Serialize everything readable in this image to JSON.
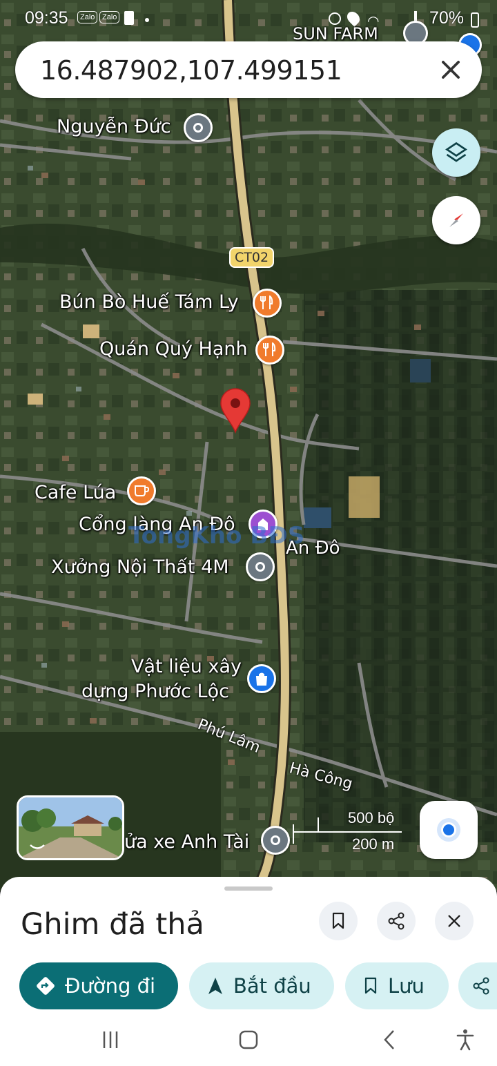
{
  "status_bar": {
    "time": "09:35",
    "apps": [
      "Zalo",
      "Zalo"
    ],
    "battery": "70%"
  },
  "search": {
    "query": "16.487902,107.499151"
  },
  "map": {
    "top_labels": [
      "SUN FARM"
    ],
    "road_shield": "CT02",
    "places": [
      {
        "name": "Nguyễn Đức",
        "icon": "location-pin-icon"
      },
      {
        "name": "Bún Bò Huế Tám Ly",
        "icon": "restaurant-icon"
      },
      {
        "name": "Quán Quý Hạnh",
        "icon": "restaurant-icon"
      },
      {
        "name": "Cafe Lúa",
        "icon": "cafe-icon"
      },
      {
        "name": "Cổng làng An Đô",
        "icon": "landmark-icon"
      },
      {
        "name": "Xưởng Nội Thất 4M",
        "icon": "location-pin-icon"
      },
      {
        "name": "Vật liệu xây",
        "icon": "shopping-bag-icon"
      },
      {
        "name": "dựng Phước Lộc",
        "icon": ""
      },
      {
        "name": "ửa xe Anh Tài",
        "icon": "location-pin-icon"
      }
    ],
    "area_labels": [
      "An Đô",
      "Phú Lâm",
      "Hà Công"
    ],
    "watermark": "TongKho BĐS",
    "scale": {
      "imperial": "500 bộ",
      "metric": "200 m"
    },
    "colors": {
      "main_road": "#d8c48c",
      "dropped_pin": "#e53935",
      "restaurant": "#f07b2c",
      "landmark": "#9c4fd1",
      "generic_pin": "#6b7780"
    }
  },
  "sheet": {
    "title": "Ghim đã thả",
    "actions": [
      {
        "label": "Đường đi",
        "icon": "directions-icon"
      },
      {
        "label": "Bắt đầu",
        "icon": "navigation-arrow-icon"
      },
      {
        "label": "Lưu",
        "icon": "bookmark-icon"
      }
    ]
  }
}
